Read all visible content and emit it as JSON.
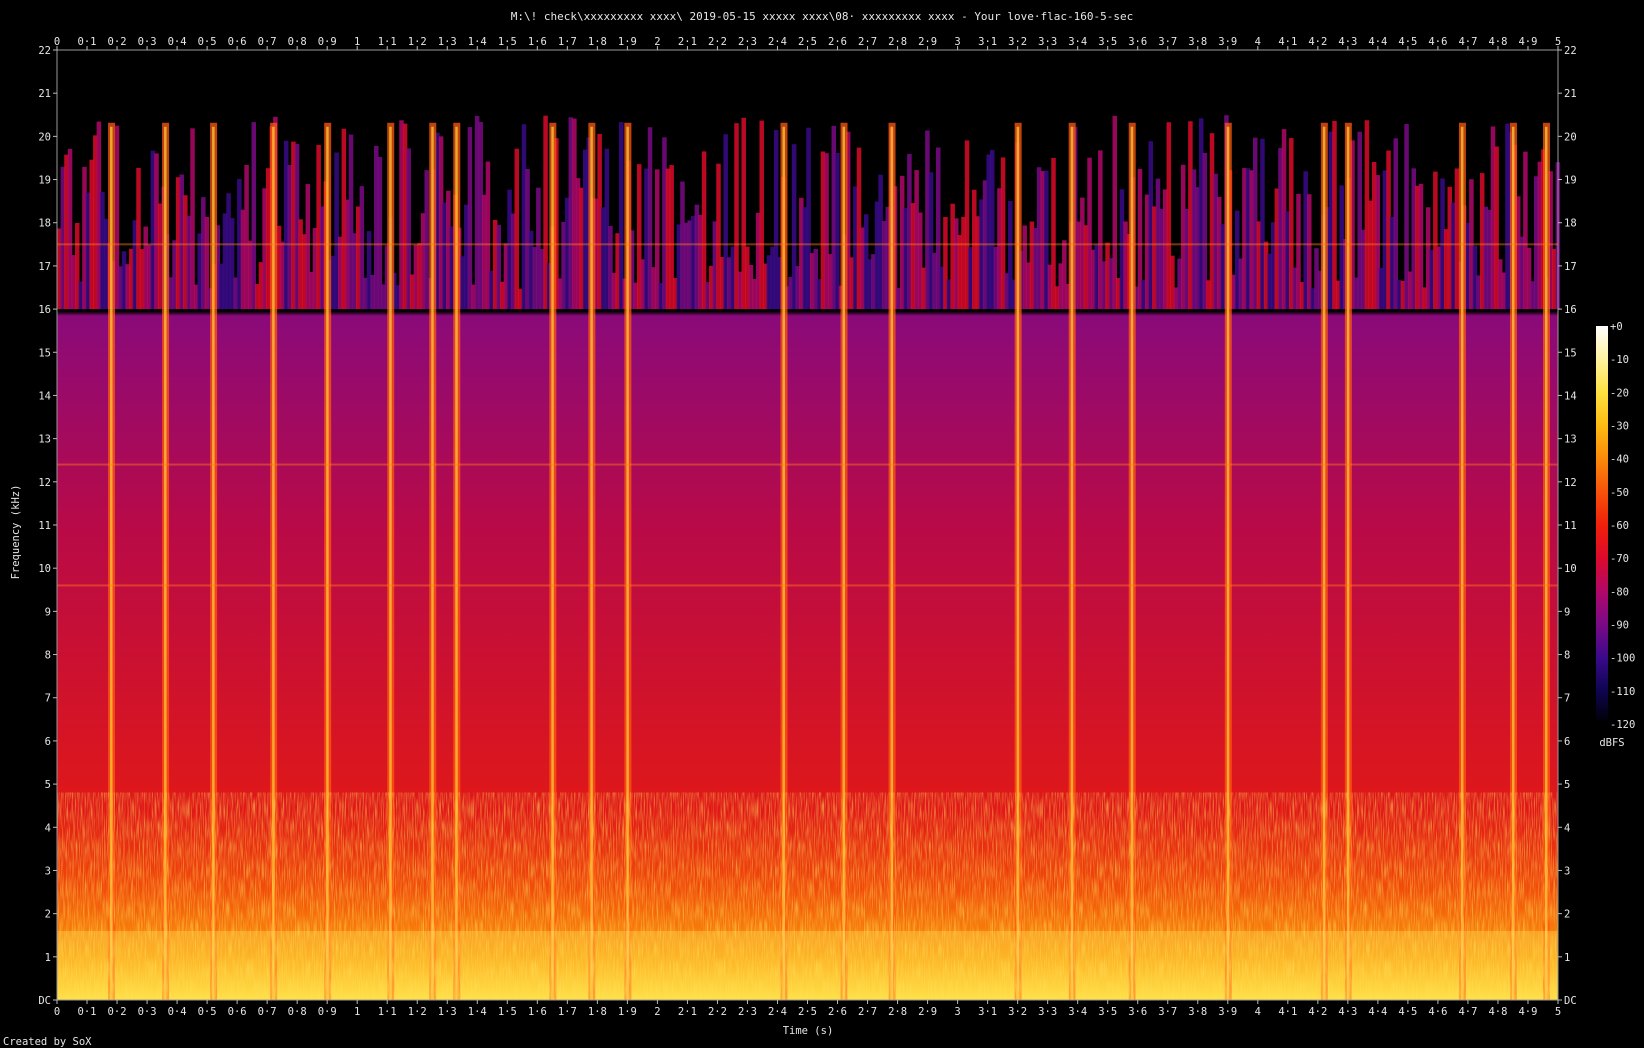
{
  "chart_data": {
    "type": "heatmap",
    "title": "M:\\! check\\xxxxxxxxx xxxx\\ 2019-05-15  xxxxx xxxx\\08· xxxxxxxxx xxxx - Your love·flac-160-5-sec",
    "xlabel": "Time (s)",
    "ylabel": "Frequency (kHz)",
    "xlim": [
      0,
      5
    ],
    "ylim": [
      0,
      22
    ],
    "x_ticks": [
      "0",
      "0·1",
      "0·2",
      "0·3",
      "0·4",
      "0·5",
      "0·6",
      "0·7",
      "0·8",
      "0·9",
      "1",
      "1·1",
      "1·2",
      "1·3",
      "1·4",
      "1·5",
      "1·6",
      "1·7",
      "1·8",
      "1·9",
      "2",
      "2·1",
      "2·2",
      "2·3",
      "2·4",
      "2·5",
      "2·6",
      "2·7",
      "2·8",
      "2·9",
      "3",
      "3·1",
      "3·2",
      "3·3",
      "3·4",
      "3·5",
      "3·6",
      "3·7",
      "3·8",
      "3·9",
      "4",
      "4·1",
      "4·2",
      "4·3",
      "4·4",
      "4·5",
      "4·6",
      "4·7",
      "4·8",
      "4·9",
      "5"
    ],
    "y_ticks": [
      "DC",
      "1",
      "2",
      "3",
      "4",
      "5",
      "6",
      "7",
      "8",
      "9",
      "10",
      "11",
      "12",
      "13",
      "14",
      "15",
      "16",
      "17",
      "18",
      "19",
      "20",
      "21",
      "22"
    ],
    "colorbar": {
      "label": "dBFS",
      "ticks": [
        "+0",
        "-10",
        "-20",
        "-30",
        "-40",
        "-50",
        "-60",
        "-70",
        "-80",
        "-90",
        "-100",
        "-110",
        "-120"
      ],
      "range": [
        -120,
        0
      ],
      "colors": [
        "#000000",
        "#0d0550",
        "#3a0a8a",
        "#7a0a86",
        "#b0086a",
        "#dc0a2a",
        "#f0200a",
        "#f7520a",
        "#fb8a0a",
        "#fdbb12",
        "#fde040",
        "#fff3a0",
        "#ffffff"
      ]
    },
    "observed_features": {
      "lowpass_cutoff_khz": 16,
      "sporadic_content_up_to_khz": 20.5,
      "transient_times_s": [
        0.18,
        0.36,
        0.52,
        0.72,
        0.9,
        1.11,
        1.25,
        1.33,
        1.65,
        1.78,
        1.9,
        2.42,
        2.62,
        2.78,
        3.2,
        3.38,
        3.58,
        3.9,
        4.22,
        4.3,
        4.68,
        4.85,
        4.96
      ],
      "tonal_line_khz": [
        17.5,
        12.4,
        9.6
      ]
    }
  },
  "footer": {
    "created_by": "Created by SoX"
  }
}
